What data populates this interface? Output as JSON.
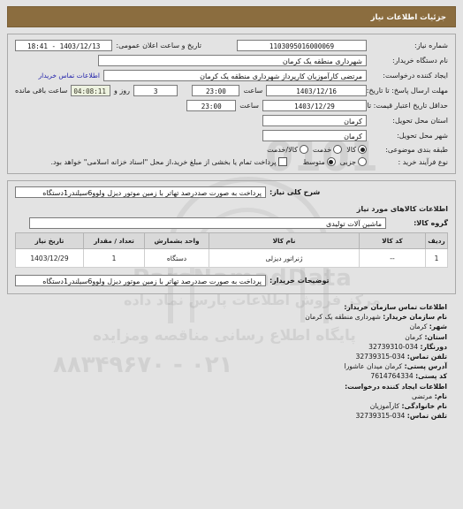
{
  "header": {
    "title": "جزئیات اطلاعات نیاز"
  },
  "form": {
    "need_number_label": "شماره نیاز:",
    "need_number_value": "1103095016000069",
    "announce_datetime_label": "تاریخ و ساعت اعلان عمومی:",
    "announce_datetime_value": "1403/12/13 - 18:41",
    "buyer_org_label": "نام دستگاه خریدار:",
    "buyer_org_value": "شهرداری منطقه یک کرمان",
    "creator_label": "ایجاد کننده درخواست:",
    "creator_value": "مرتضی کارآموزیان کارپرداز شهرداری منطقه یک کرمان",
    "contact_link": "اطلاعات تماس خریدار",
    "reply_deadline_label": "مهلت ارسال پاسخ: تا تاریخ:",
    "reply_deadline_date": "1403/12/16",
    "hour_label": "ساعت",
    "reply_deadline_time": "23:00",
    "days_value": "3",
    "days_label": "روز و",
    "remaining_time": "04:08:11",
    "remaining_label": "ساعت باقی مانده",
    "price_validity_label": "حداقل تاریخ اعتبار قیمت: تا تاریخ:",
    "price_validity_date": "1403/12/29",
    "price_validity_time": "23:00",
    "delivery_province_label": "استان محل تحویل:",
    "delivery_province_value": "کرمان",
    "delivery_city_label": "شهر محل تحویل:",
    "delivery_city_value": "کرمان",
    "category_label": "طبقه بندی موضوعی:",
    "category_options": [
      {
        "label": "کالا",
        "selected": true
      },
      {
        "label": "خدمت",
        "selected": false
      },
      {
        "label": "کالا/خدمت",
        "selected": false
      }
    ],
    "process_label": "نوع فرآیند خرید :",
    "process_options": [
      {
        "label": "جزیی",
        "selected": false
      },
      {
        "label": "متوسط",
        "selected": true
      }
    ],
    "treasury_checkbox_label": "پرداخت تمام یا بخشی از مبلغ خرید،از محل \"اسناد خزانه اسلامی\" خواهد بود.",
    "treasury_checked": false
  },
  "need_description": {
    "label": "شرح کلی نیاز:",
    "value": "پرداخت به صورت صددرصد تهاتر با زمین موتور دیزل ولوو6سیلندر1دستگاه"
  },
  "goods_section": {
    "title": "اطلاعات کالاهای مورد نیاز",
    "group_label": "گروه کالا:",
    "group_value": "ماشین آلات تولیدی",
    "columns": [
      "ردیف",
      "کد کالا",
      "نام کالا",
      "واحد بشمارش",
      "تعداد / مقدار",
      "تاریخ نیاز"
    ],
    "rows": [
      {
        "radif": "1",
        "code": "--",
        "name": "ژنراتور دیزلی",
        "unit": "دستگاه",
        "qty": "1",
        "date": "1403/12/29"
      }
    ]
  },
  "buyer_notes": {
    "label": "توضیحات خریدار:",
    "value": "پرداخت به صورت صددرصد تهاتر با زمین موتور دیزل ولوو6سیلندر1دستگاه"
  },
  "contact": {
    "org_section_title": "اطلاعات تماس سازمان خریدار:",
    "org_name_label": "نام سازمان خریدار:",
    "org_name_value": "شهرداری منطقه یک کرمان",
    "city_label": "شهر:",
    "city_value": "کرمان",
    "province_label": "استان:",
    "province_value": "کرمان",
    "fax_label": "دورنگار:",
    "fax_value": "32739310-034",
    "phone_label": "تلفن تماس:",
    "phone_value": "32739315-034",
    "address_label": "آدرس پستی:",
    "address_value": "کرمان میدان عاشورا",
    "postal_code_label": "کد پستی:",
    "postal_code_value": "7614764334",
    "creator_section_title": "اطلاعات ایجاد کننده درخواست:",
    "first_name_label": "نام:",
    "first_name_value": "مرتضی",
    "last_name_label": "نام خانوادگی:",
    "last_name_value": "کارآموزیان",
    "creator_phone_label": "تلفن تماس:",
    "creator_phone_value": "32739315-034"
  },
  "watermark": {
    "brand": "ParsNamadData",
    "line1": "مرکز فروش اطلاعات پارس نماد داده",
    "line2": "پایگاه اطلاع رسانی مناقصه ومزایده",
    "phone": "۰۲۱ - ۸۸۳۴۹۶۷۰",
    "numbers": "0101"
  }
}
